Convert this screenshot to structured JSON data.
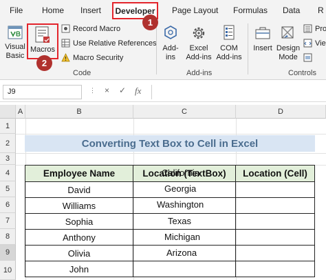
{
  "tabs": [
    "File",
    "Home",
    "Insert",
    "Developer",
    "Page Layout",
    "Formulas",
    "Data",
    "R"
  ],
  "ribbon": {
    "visual_basic": "Visual\nBasic",
    "macros": "Macros",
    "record_macro": "Record Macro",
    "relative_refs": "Use Relative References",
    "macro_security": "Macro Security",
    "code_label": "Code",
    "add_ins": "Add-\nins",
    "excel_add_ins": "Excel\nAdd-ins",
    "com_add_ins": "COM\nAdd-ins",
    "add_ins_label": "Add-ins",
    "insert": "Insert",
    "design_mode": "Design\nMode",
    "pro": "Pro",
    "vie": "Vie",
    "controls_label": "Controls",
    "badge1": "1",
    "badge2": "2"
  },
  "formula_bar": {
    "name_box": "J9",
    "cancel": "×",
    "enter": "✓",
    "fx": "fx",
    "value": ""
  },
  "columns": [
    "A",
    "B",
    "C",
    "D"
  ],
  "rows": [
    "1",
    "2",
    "3",
    "4",
    "5",
    "6",
    "7",
    "8",
    "9",
    "10"
  ],
  "sheet": {
    "title": "Converting Text Box to Cell in Excel",
    "headers": [
      "Employee Name",
      "Location (TextBox)",
      "Location (Cell)"
    ],
    "names": [
      "David",
      "Williams",
      "Sophia",
      "Anthony",
      "Olivia",
      "John"
    ],
    "locations": [
      "California",
      "Georgia",
      "Washington",
      "Texas",
      "Michigan",
      "Arizona"
    ]
  },
  "colors": {
    "highlight": "#e3242b",
    "badge": "#b0312e",
    "title_bg": "#d9e5f3",
    "header_bg": "#e2efda"
  }
}
